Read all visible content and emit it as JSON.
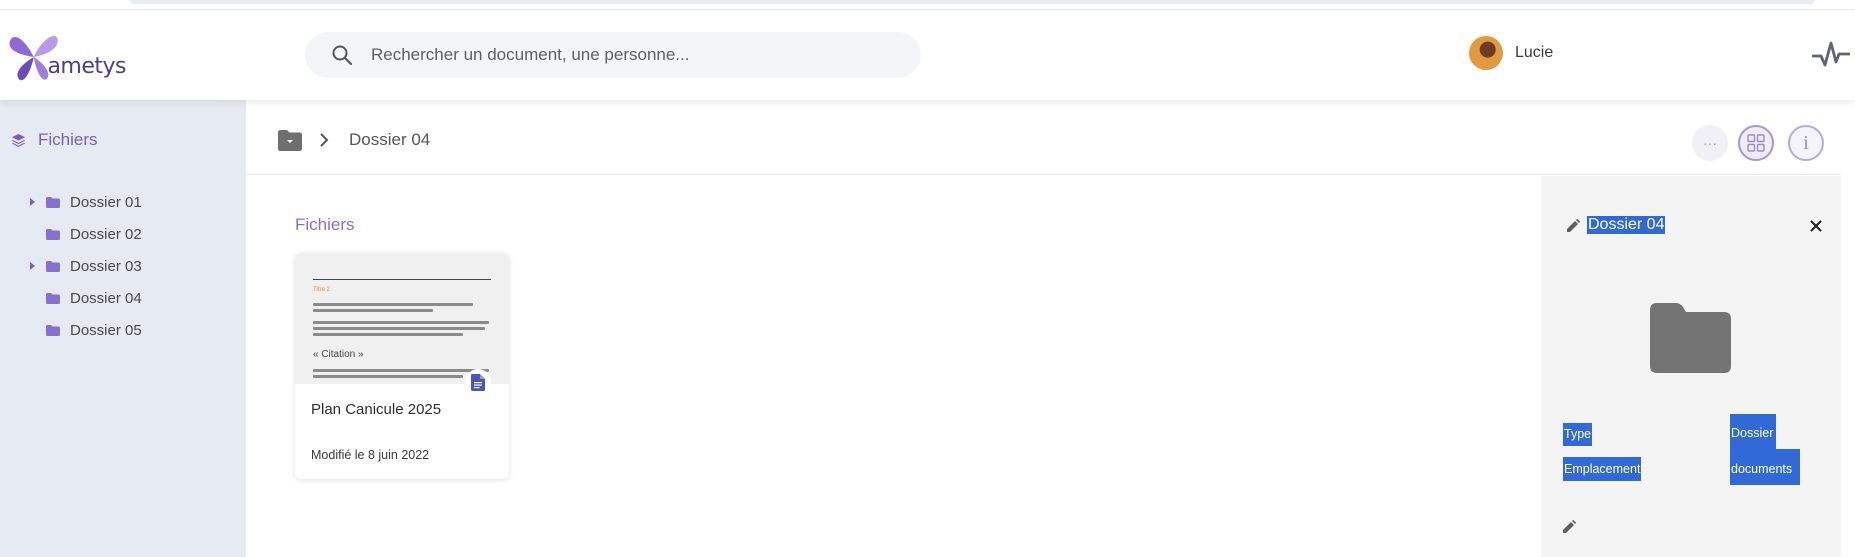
{
  "header": {
    "logo_text": "ametys",
    "search_placeholder": "Rechercher un document, une personne...",
    "user_name": "Lucie"
  },
  "sidebar": {
    "title": "Fichiers",
    "items": [
      {
        "label": "Dossier 01",
        "expandable": true
      },
      {
        "label": "Dossier 02",
        "expandable": false
      },
      {
        "label": "Dossier 03",
        "expandable": true
      },
      {
        "label": "Dossier 04",
        "expandable": false
      },
      {
        "label": "Dossier 05",
        "expandable": false
      }
    ]
  },
  "toolbar": {
    "breadcrumb": "Dossier 04",
    "more_label": "···",
    "info_label": "i"
  },
  "main": {
    "section_title": "Fichiers",
    "files": [
      {
        "name": "Plan Canicule 2025",
        "modified": "Modifié le 8 juin 2022",
        "thumb_heading": "Titre 2",
        "thumb_quote": "« Citation »"
      }
    ]
  },
  "details": {
    "title": "Dossier 04",
    "type_label": "Type",
    "type_value": "Dossier",
    "location_label": "Emplacement",
    "location_value": "documents"
  },
  "colors": {
    "accent": "#7b5cc4",
    "selection": "#3169d6",
    "sidebar_bg": "#e6eaf3",
    "folder": "#747474"
  }
}
